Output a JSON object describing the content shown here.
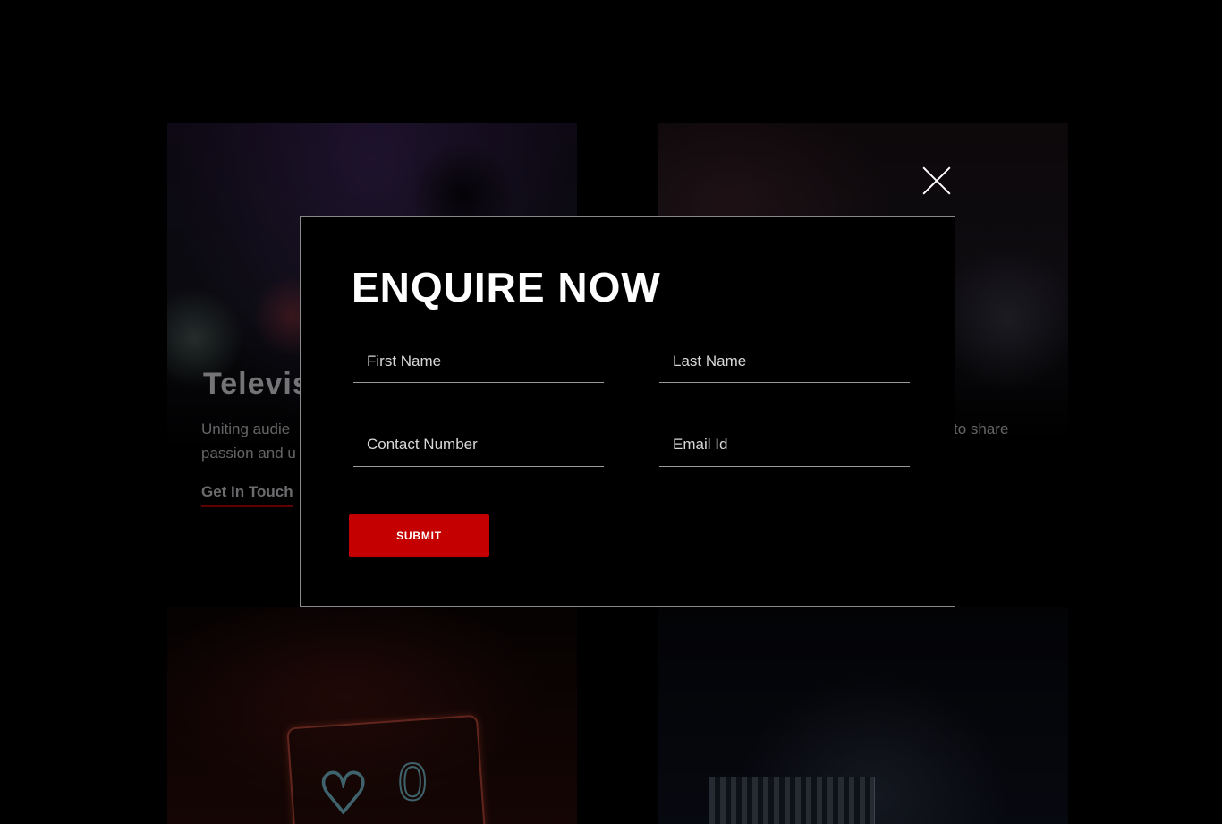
{
  "background_cards": {
    "television": {
      "title": "Televis",
      "description": "Uniting audie\npassion and u",
      "link": "Get In Touch"
    },
    "radio": {
      "description_fragment": "to share"
    }
  },
  "modal": {
    "close_icon": "close-icon",
    "title": "ENQUIRE NOW",
    "fields": {
      "first_name": {
        "placeholder": "First Name",
        "value": ""
      },
      "last_name": {
        "placeholder": "Last Name",
        "value": ""
      },
      "contact_number": {
        "placeholder": "Contact Number",
        "value": ""
      },
      "email": {
        "placeholder": "Email Id",
        "value": ""
      }
    },
    "submit_label": "SUBMIT"
  },
  "colors": {
    "accent": "#c40000",
    "modal_bg": "#000000",
    "modal_border": "#8a8a8a",
    "field_underline": "#9a9a9a"
  }
}
